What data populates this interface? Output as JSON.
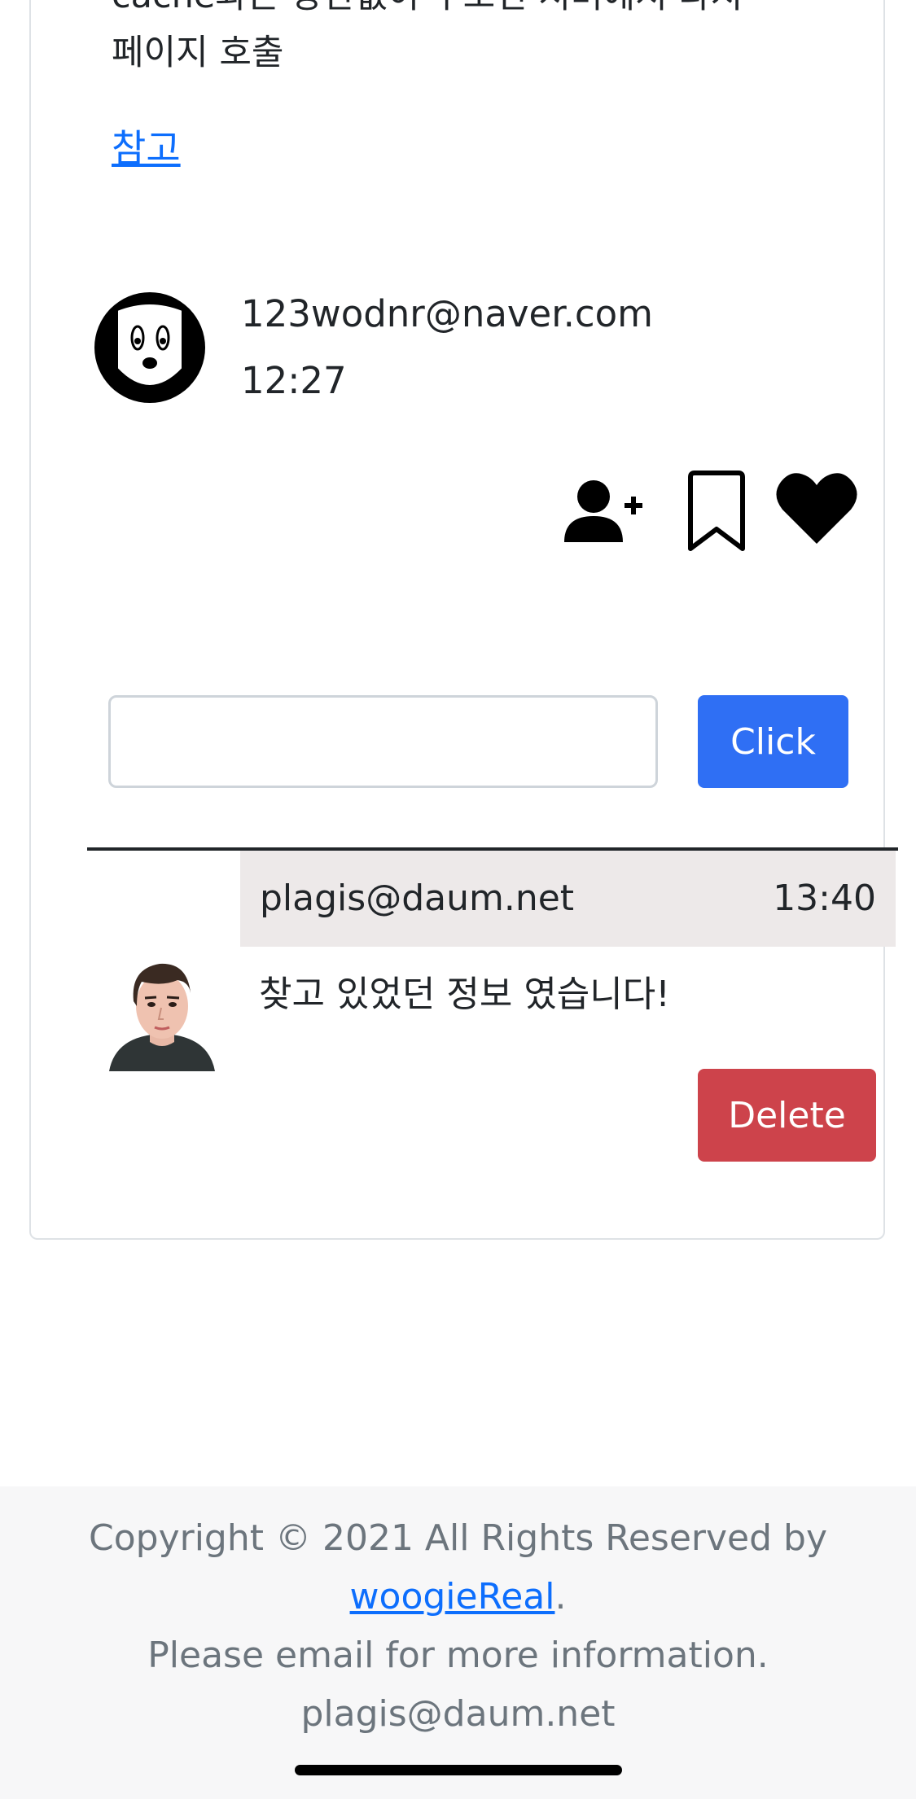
{
  "post": {
    "body_text_line1": "cache와는 상관없이 무조건 서버에서 다시",
    "body_text_line2": "페이지 호출",
    "reference_link": "참고"
  },
  "author": {
    "email": "123wodnr@naver.com",
    "time": "12:27"
  },
  "actions": {
    "follow_icon": "person-plus-icon",
    "bookmark_icon": "bookmark-icon",
    "like_icon": "heart-icon"
  },
  "comment_form": {
    "input_value": "",
    "submit_label": "Click"
  },
  "comments": [
    {
      "author": "plagis@daum.net",
      "time": "13:40",
      "text": "찾고 있었던 정보 였습니다!",
      "delete_label": "Delete"
    }
  ],
  "footer": {
    "copyright": "Copyright © 2021 All Rights Reserved by",
    "owner_link": "woogieReal",
    "owner_suffix": ".",
    "info": "Please email for more information.",
    "email": "plagis@daum.net"
  },
  "colors": {
    "primary": "#2f6ff4",
    "danger": "#cd434b",
    "link": "#0d6efd",
    "comment_header_bg": "#ede9e9",
    "footer_bg": "#f7f7f8"
  }
}
